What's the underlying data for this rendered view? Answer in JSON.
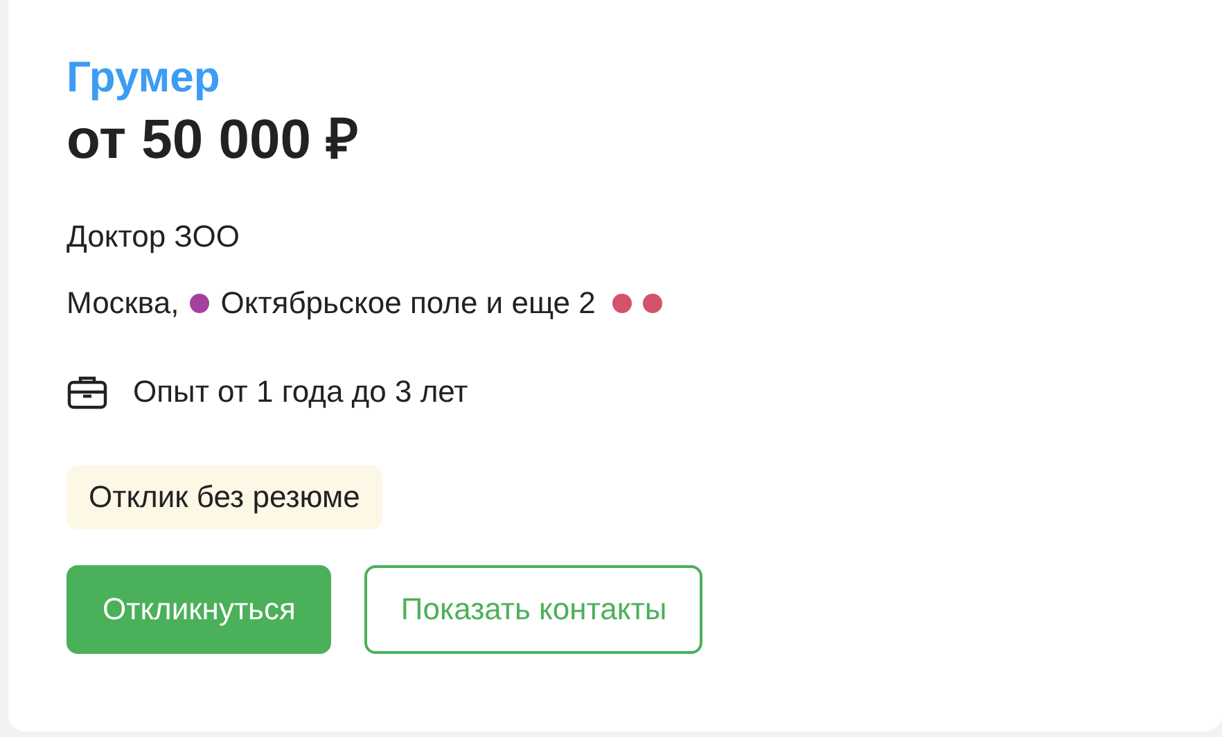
{
  "vacancy": {
    "title": "Грумер",
    "salary": "от 50 000 ₽",
    "company": "Доктор ЗОО",
    "location": {
      "city": "Москва,",
      "leading_dots": [
        {
          "color": "#a4419d"
        }
      ],
      "station": "Октябрьское поле и еще 2",
      "trailing_dots": [
        {
          "color": "#d5526c"
        },
        {
          "color": "#d5526c"
        }
      ]
    },
    "experience": "Опыт от 1 года до 3 лет",
    "badge": "Отклик без резюме",
    "buttons": [
      {
        "label": "Откликнуться",
        "kind": "primary"
      },
      {
        "label": "Показать контакты",
        "kind": "outline"
      }
    ]
  }
}
